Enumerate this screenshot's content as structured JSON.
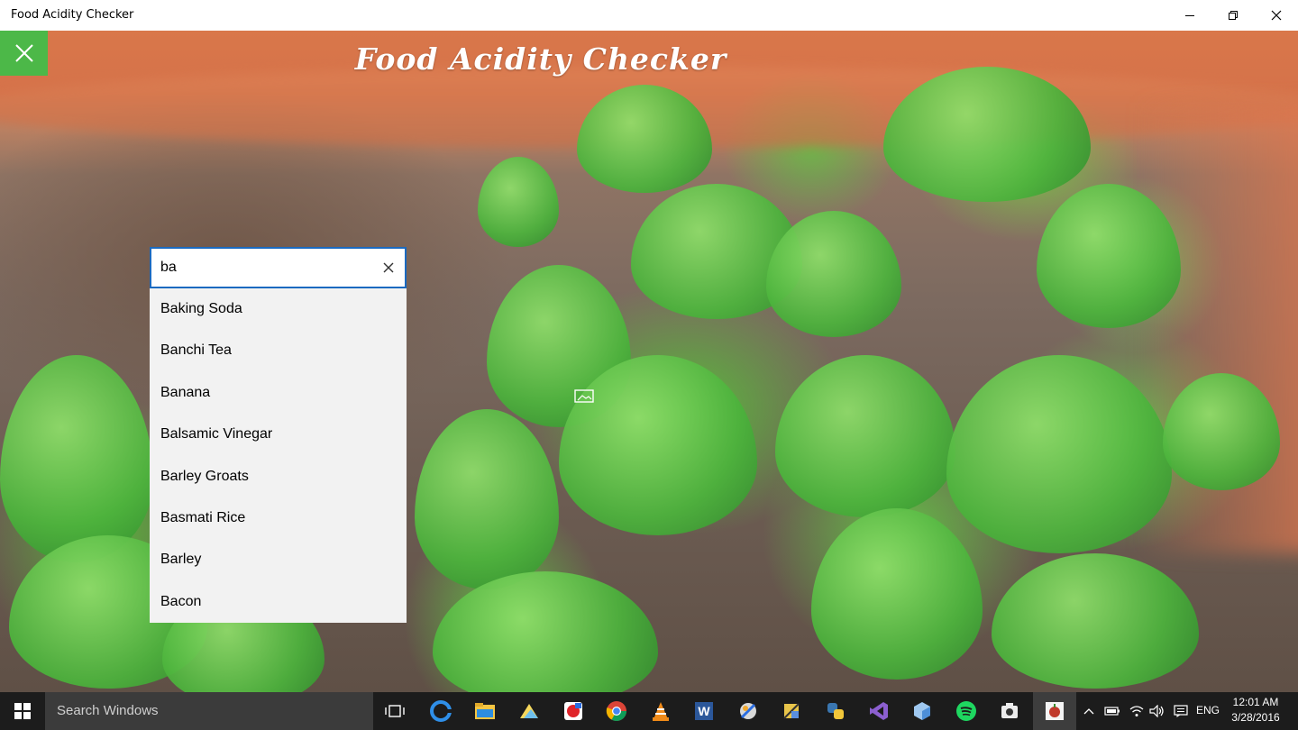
{
  "window": {
    "title": "Food Acidity Checker",
    "controls": [
      "minimize",
      "restore",
      "close"
    ]
  },
  "app": {
    "title": "Food Acidity Checker",
    "accent_color": "#4cb848"
  },
  "search": {
    "value": "ba",
    "border_color": "#1b6ac0",
    "suggestions": [
      {
        "label": "Baking Soda"
      },
      {
        "label": "Banchi Tea"
      },
      {
        "label": "Banana"
      },
      {
        "label": "Balsamic Vinegar"
      },
      {
        "label": "Barley Groats"
      },
      {
        "label": "Basmati Rice"
      },
      {
        "label": "Barley"
      },
      {
        "label": "Bacon"
      }
    ]
  },
  "taskbar": {
    "search_placeholder": "Search Windows",
    "pinned_apps": [
      "task-view",
      "edge",
      "file-explorer",
      "folder-app",
      "paint-app",
      "chrome",
      "vlc",
      "word",
      "tools-app",
      "settings-app",
      "python",
      "visual-studio",
      "box-app",
      "spotify",
      "camera-app",
      "food-acidity-checker"
    ],
    "language": "ENG",
    "time": "12:01 AM",
    "date": "3/28/2016"
  }
}
